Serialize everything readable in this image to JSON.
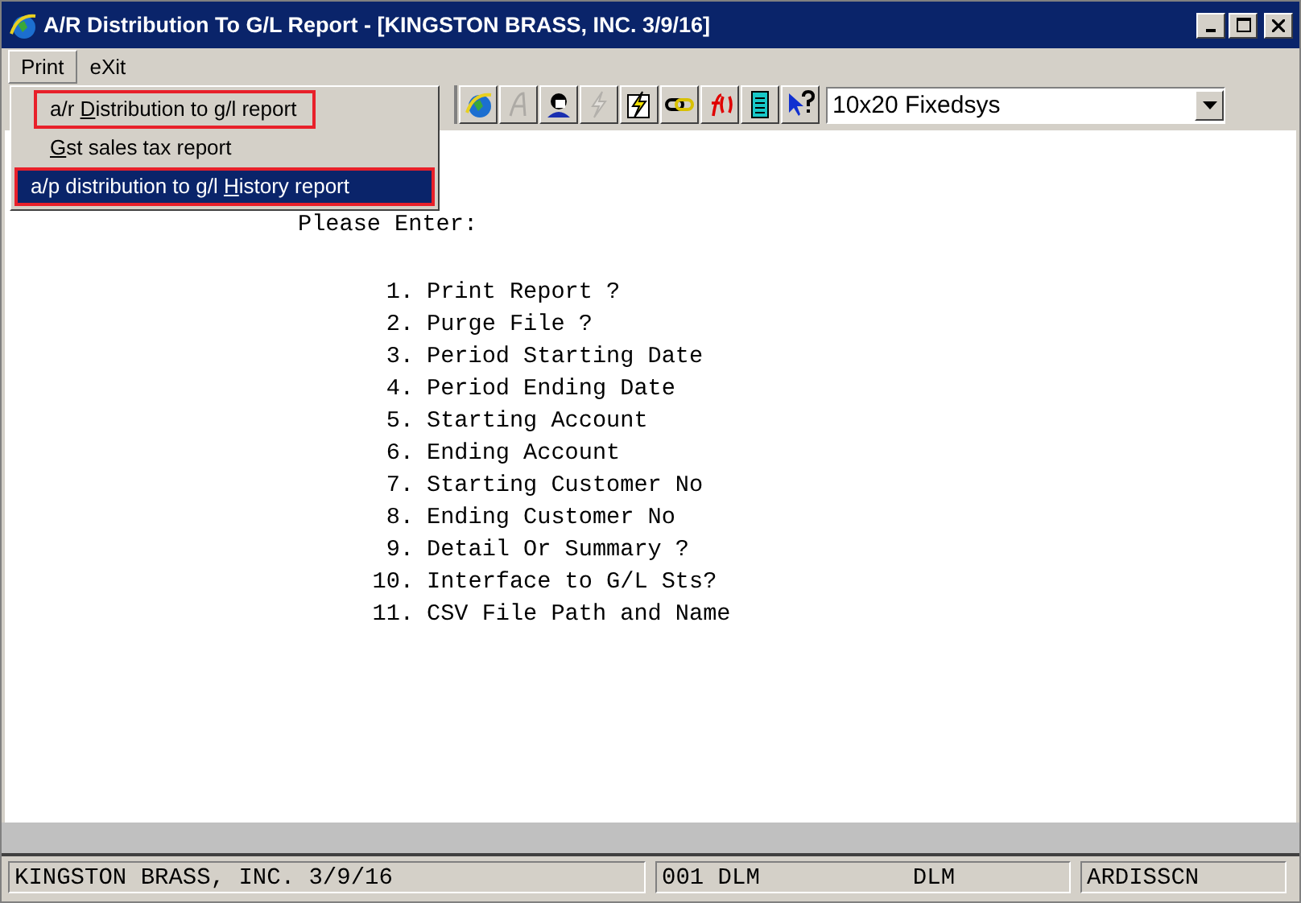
{
  "window": {
    "title": "A/R Distribution To G/L Report - [KINGSTON BRASS, INC. 3/9/16]"
  },
  "menu_bar": [
    {
      "label": "Print",
      "selected": true
    },
    {
      "label": "eXit",
      "selected": false
    }
  ],
  "dropdown": [
    {
      "before": "a/r ",
      "key": "D",
      "after": "istribution to g/l report",
      "selected": false,
      "highlighted": true
    },
    {
      "key": "G",
      "after": "st sales tax report",
      "selected": false,
      "highlighted": false
    },
    {
      "before": "a/p distribution to g/l ",
      "key": "H",
      "after": "istory report",
      "selected": true,
      "highlighted": true
    }
  ],
  "toolbar": [
    {
      "kind": "globe",
      "disabled": false
    },
    {
      "kind": "script",
      "disabled": true
    },
    {
      "kind": "person",
      "disabled": false
    },
    {
      "kind": "bolt",
      "disabled": true
    },
    {
      "kind": "boltdoc",
      "disabled": false
    },
    {
      "kind": "link",
      "disabled": false
    },
    {
      "kind": "fx",
      "disabled": false
    },
    {
      "kind": "calc",
      "disabled": false
    },
    {
      "kind": "help",
      "disabled": false
    }
  ],
  "font_select": {
    "value": "10x20 Fixedsys"
  },
  "prompt": "Please Enter:",
  "options": [
    {
      "number": "1.",
      "label": "Print Report ?"
    },
    {
      "number": "2.",
      "label": "Purge File ?"
    },
    {
      "number": "3.",
      "label": "Period Starting Date"
    },
    {
      "number": "4.",
      "label": "Period Ending Date"
    },
    {
      "number": "5.",
      "label": "Starting Account"
    },
    {
      "number": "6.",
      "label": "Ending Account"
    },
    {
      "number": "7.",
      "label": "Starting Customer No"
    },
    {
      "number": "8.",
      "label": "Ending Customer No"
    },
    {
      "number": "9.",
      "label": "Detail Or Summary ?"
    },
    {
      "number": "10.",
      "label": "Interface to G/L Sts?"
    },
    {
      "number": "11.",
      "label": "CSV File Path and Name"
    }
  ],
  "status_bar": {
    "company": "KINGSTON BRASS, INC. 3/9/16",
    "user_1": "001 DLM",
    "user_2": "DLM",
    "program": "ARDISSCN"
  }
}
